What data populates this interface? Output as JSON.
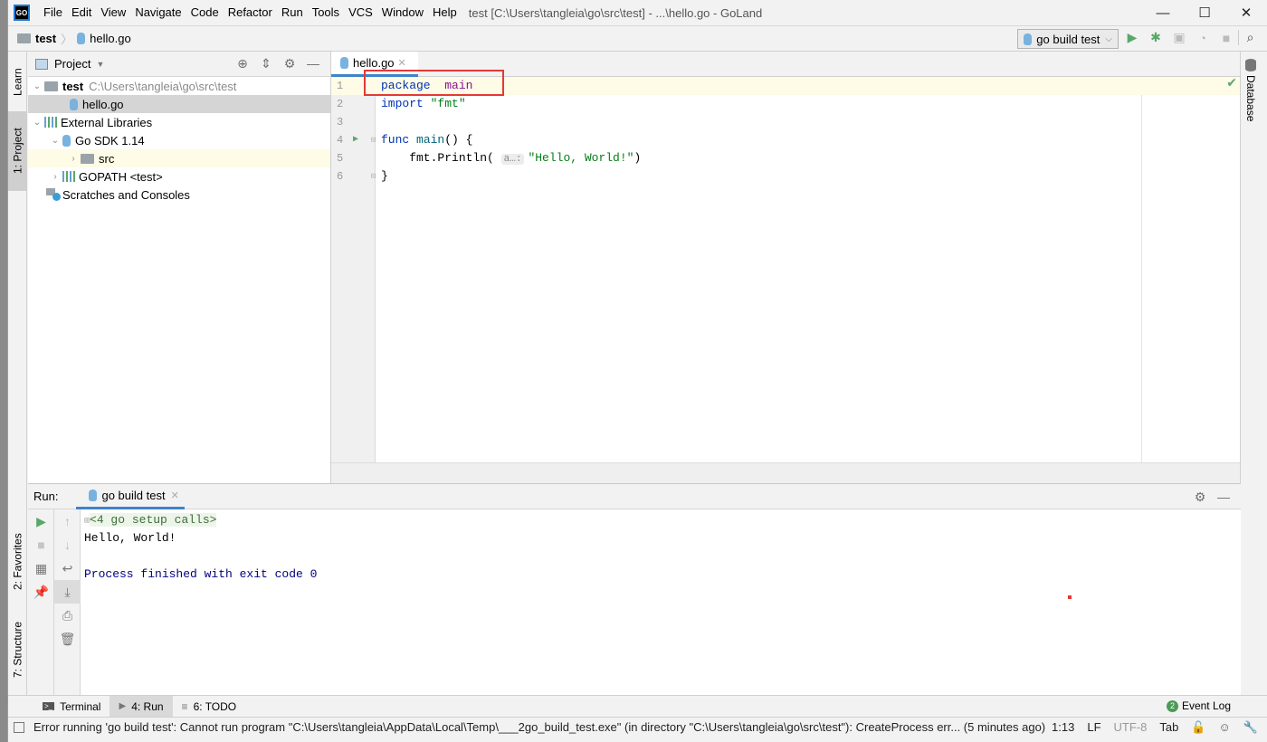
{
  "window": {
    "app_logo": "GO",
    "title": "test [C:\\Users\\tangleia\\go\\src\\test] - ...\\hello.go - GoLand",
    "menu": [
      "File",
      "Edit",
      "View",
      "Navigate",
      "Code",
      "Refactor",
      "Run",
      "Tools",
      "VCS",
      "Window",
      "Help"
    ],
    "controls": {
      "minimize": "—",
      "maximize": "☐",
      "close": "✕"
    }
  },
  "navbar": {
    "breadcrumb": [
      "test",
      "hello.go"
    ],
    "run_config": "go build test",
    "icons": [
      "run-icon",
      "debug-icon",
      "coverage-icon",
      "profile-icon",
      "stop-icon",
      "search-icon"
    ]
  },
  "left_strip": {
    "tabs": [
      "Learn",
      "1: Project",
      "2: Favorites",
      "7: Structure"
    ]
  },
  "right_strip": {
    "tabs": [
      "Database"
    ]
  },
  "project": {
    "header": "Project",
    "tree": [
      {
        "label": "test",
        "path": "C:\\Users\\tangleia\\go\\src\\test",
        "expanded": true,
        "depth": 0,
        "icon": "folder"
      },
      {
        "label": "hello.go",
        "depth": 1,
        "icon": "gopher",
        "selected": true
      },
      {
        "label": "External Libraries",
        "expanded": true,
        "depth": 0,
        "icon": "library"
      },
      {
        "label": "Go SDK 1.14",
        "expanded": true,
        "depth": 1,
        "icon": "gopher"
      },
      {
        "label": "src",
        "expanded": false,
        "depth": 2,
        "icon": "folder",
        "highlighted": true
      },
      {
        "label": "GOPATH <test>",
        "expanded": false,
        "depth": 1,
        "icon": "library"
      },
      {
        "label": "Scratches and Consoles",
        "depth": 0,
        "icon": "scratch"
      }
    ]
  },
  "editor": {
    "tab": "hello.go",
    "lines": [
      {
        "n": "1",
        "tokens": [
          [
            "kw",
            "package"
          ],
          [
            "",
            "  "
          ],
          [
            "id",
            "main"
          ]
        ]
      },
      {
        "n": "2",
        "tokens": [
          [
            "kw",
            "import"
          ],
          [
            "",
            " "
          ],
          [
            "str",
            "\"fmt\""
          ]
        ]
      },
      {
        "n": "3",
        "tokens": []
      },
      {
        "n": "4",
        "tokens": [
          [
            "kw",
            "func"
          ],
          [
            "",
            " "
          ],
          [
            "fn",
            "main"
          ],
          [
            "",
            "() {"
          ]
        ]
      },
      {
        "n": "5",
        "tokens": [
          [
            "",
            "    fmt.Println( "
          ],
          [
            "hint",
            "a…:"
          ],
          [
            "str",
            "\"Hello, World!\""
          ],
          [
            "",
            ")"
          ]
        ]
      },
      {
        "n": "6",
        "tokens": [
          [
            "",
            "}"
          ]
        ]
      }
    ],
    "line1_text": "package main"
  },
  "run": {
    "label": "Run:",
    "tab": "go build test",
    "output": [
      "<4 go setup calls>",
      "Hello, World!",
      "",
      "Process finished with exit code 0"
    ]
  },
  "bottom_tabs": [
    "Terminal",
    "4: Run",
    "6: TODO"
  ],
  "event_log": {
    "count": "2",
    "label": "Event Log"
  },
  "status": {
    "message": "Error running 'go build test': Cannot run program \"C:\\Users\\tangleia\\AppData\\Local\\Temp\\___2go_build_test.exe\" (in directory \"C:\\Users\\tangleia\\go\\src\\test\"): CreateProcess err... (5 minutes ago)",
    "position": "1:13",
    "line_sep": "LF",
    "encoding": "UTF-8",
    "indent": "Tab"
  }
}
